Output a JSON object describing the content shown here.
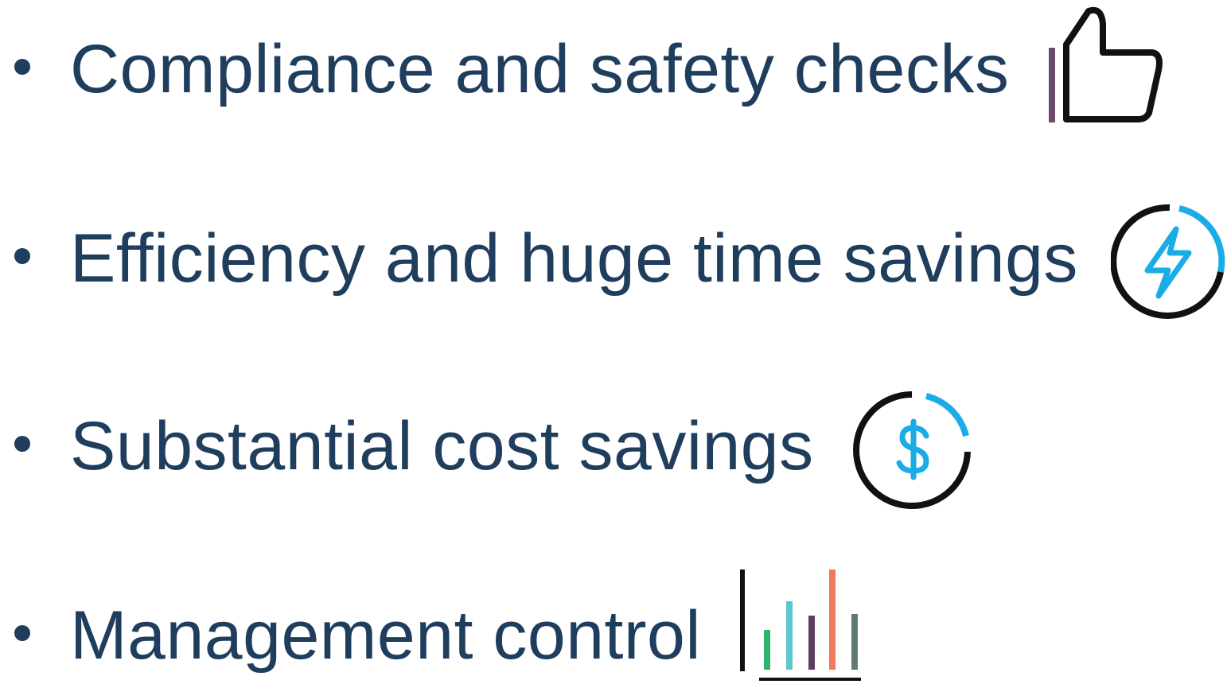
{
  "bullets": [
    {
      "text": "Compliance and safety checks",
      "icon": "thumbs-up-icon"
    },
    {
      "text": "Efficiency and huge time savings",
      "icon": "lightning-bolt-icon"
    },
    {
      "text": "Substantial cost savings",
      "icon": "dollar-circle-icon"
    },
    {
      "text": "Management control",
      "icon": "bar-chart-icon"
    }
  ],
  "colors": {
    "text": "#1f3d5c",
    "accent_blue": "#1aace6",
    "icon_black": "#111111",
    "thumb_bar": "#6b4a6e",
    "bar_green": "#2db36b",
    "bar_teal": "#5cc6cc",
    "bar_purple": "#5a3f5e",
    "bar_orange": "#f07a5e",
    "bar_slate": "#5f7a70"
  }
}
